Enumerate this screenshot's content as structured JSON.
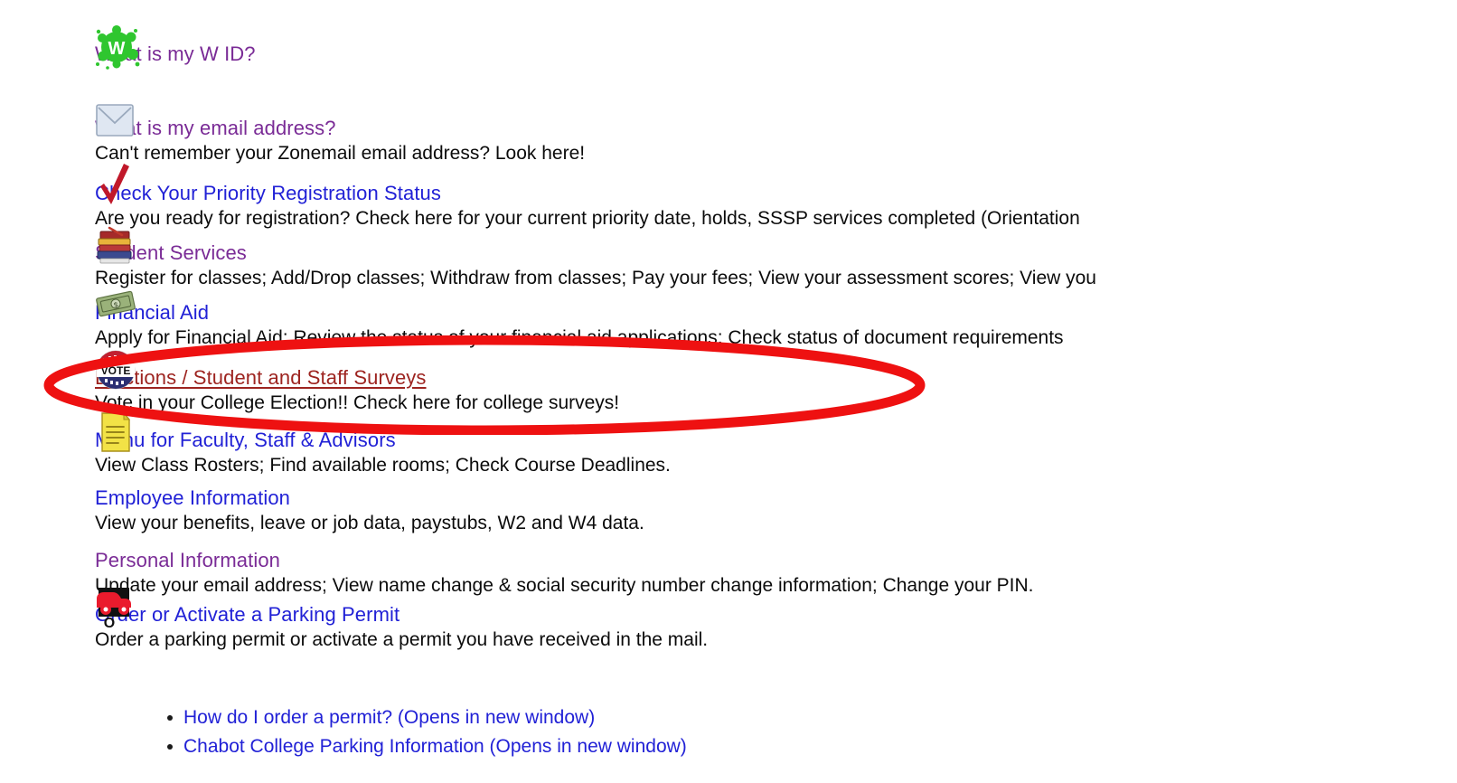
{
  "page": {
    "background_color": "#ffffff",
    "link_color_blue": "#2121d6",
    "link_color_purple": "#7a2b96",
    "link_color_visited_darkred": "#9d2420",
    "annotation_color": "#ee1111",
    "body_text_color": "#0b0b0b"
  },
  "menu": {
    "items": [
      {
        "icon": "green-splat-w-icon",
        "title": "What is my W ID?",
        "title_color": "purple",
        "description": ""
      },
      {
        "icon": "envelope-icon",
        "title": "What is my email address?",
        "title_color": "purple",
        "description": "Can't remember your Zonemail email address? Look here!"
      },
      {
        "icon": "red-checkmark-icon",
        "title": "Check Your Priority Registration Status",
        "title_color": "blue",
        "description": "Are you ready for registration? Check here for your current priority date, holds, SSSP services completed (Orientation"
      },
      {
        "icon": "stack-of-books-icon",
        "title": "Student Services",
        "title_color": "purple",
        "description": "Register for classes; Add/Drop classes; Withdraw from classes; Pay your fees; View your assessment scores; View you"
      },
      {
        "icon": "money-bills-icon",
        "title": "Financial Aid",
        "title_color": "blue",
        "description": "Apply for Financial Aid; Review the status of your financial aid applications; Check status of document requirements"
      },
      {
        "icon": "vote-button-icon",
        "title": "Elections / Student and Staff Surveys",
        "title_color": "darkred-underlined",
        "description": "Vote in your College Election!! Check here for college surveys!"
      },
      {
        "icon": "yellow-notepad-icon",
        "title": "Menu for Faculty, Staff & Advisors",
        "title_color": "blue",
        "description": "View Class Rosters; Find available rooms; Check Course Deadlines."
      },
      {
        "icon": "none",
        "title": "Employee Information",
        "title_color": "blue",
        "description": "View your benefits, leave or job data, paystubs, W2 and W4 data."
      },
      {
        "icon": "none",
        "title": "Personal Information",
        "title_color": "purple",
        "description": "Update your email address; View name change & social security number change information; Change your PIN."
      },
      {
        "icon": "red-car-parking-icon",
        "title": "Order or Activate a Parking Permit",
        "title_color": "blue",
        "description": "Order a parking permit or activate a permit you have received in the mail."
      }
    ]
  },
  "parking_links": {
    "items": [
      "How do I order a permit? (Opens in new window)",
      "Chabot College Parking Information (Opens in new window)"
    ]
  },
  "annotation": {
    "shape": "ellipse",
    "target": "Elections / Student and Staff Surveys",
    "color": "#ee1111"
  }
}
